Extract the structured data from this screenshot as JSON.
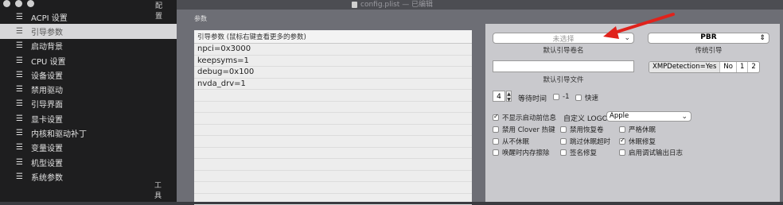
{
  "window": {
    "title": "config.plist — 已编辑"
  },
  "sidebar": {
    "top_label": "配置",
    "bottom_label": "工具",
    "items": [
      {
        "label": "ACPI 设置",
        "active": false
      },
      {
        "label": "引导参数",
        "active": true
      },
      {
        "label": "启动背景",
        "active": false
      },
      {
        "label": "CPU 设置",
        "active": false
      },
      {
        "label": "设备设置",
        "active": false
      },
      {
        "label": "禁用驱动",
        "active": false
      },
      {
        "label": "引导界面",
        "active": false
      },
      {
        "label": "显卡设置",
        "active": false
      },
      {
        "label": "内核和驱动补丁",
        "active": false
      },
      {
        "label": "变量设置",
        "active": false
      },
      {
        "label": "机型设置",
        "active": false
      },
      {
        "label": "系统参数",
        "active": false
      }
    ]
  },
  "main": {
    "section_label": "参数",
    "args_header": "引导参数 (鼠标右键查看更多的参数)",
    "args": [
      "npci=0x3000",
      "keepsyms=1",
      "debug=0x100",
      "nvda_drv=1"
    ]
  },
  "right": {
    "default_volume": {
      "value": "未选择",
      "caption": "默认引导卷名"
    },
    "legacy": {
      "value": "PBR",
      "caption": "传统引导"
    },
    "default_loader": {
      "value": "",
      "caption": "默认引导文件"
    },
    "xmp": {
      "options": [
        "XMPDetection=Yes",
        "No",
        "1",
        "2"
      ]
    },
    "timeout": {
      "value": "4",
      "label": "等待时间",
      "minus_one": "-1",
      "fast": "快速"
    },
    "hide_info": {
      "label": "不显示启动前信息",
      "checked": true
    },
    "custom_logo": {
      "label": "自定义 LOGO",
      "value": "Apple"
    },
    "checkboxes": [
      {
        "label": "禁用 Clover 热键",
        "checked": false
      },
      {
        "label": "禁用恢复卷",
        "checked": false
      },
      {
        "label": "严格休眠",
        "checked": false
      },
      {
        "label": "从不休眠",
        "checked": false
      },
      {
        "label": "跳过休眠超时",
        "checked": false
      },
      {
        "label": "休眠修复",
        "checked": true
      },
      {
        "label": "唤醒时内存擦除",
        "checked": false
      },
      {
        "label": "签名修复",
        "checked": false
      },
      {
        "label": "启用调试输出日志",
        "checked": false
      }
    ]
  },
  "colors": {
    "arrow": "#e0221b",
    "sidebar_bg": "#1e1e1f",
    "panel_bg": "#c9c9cd"
  }
}
